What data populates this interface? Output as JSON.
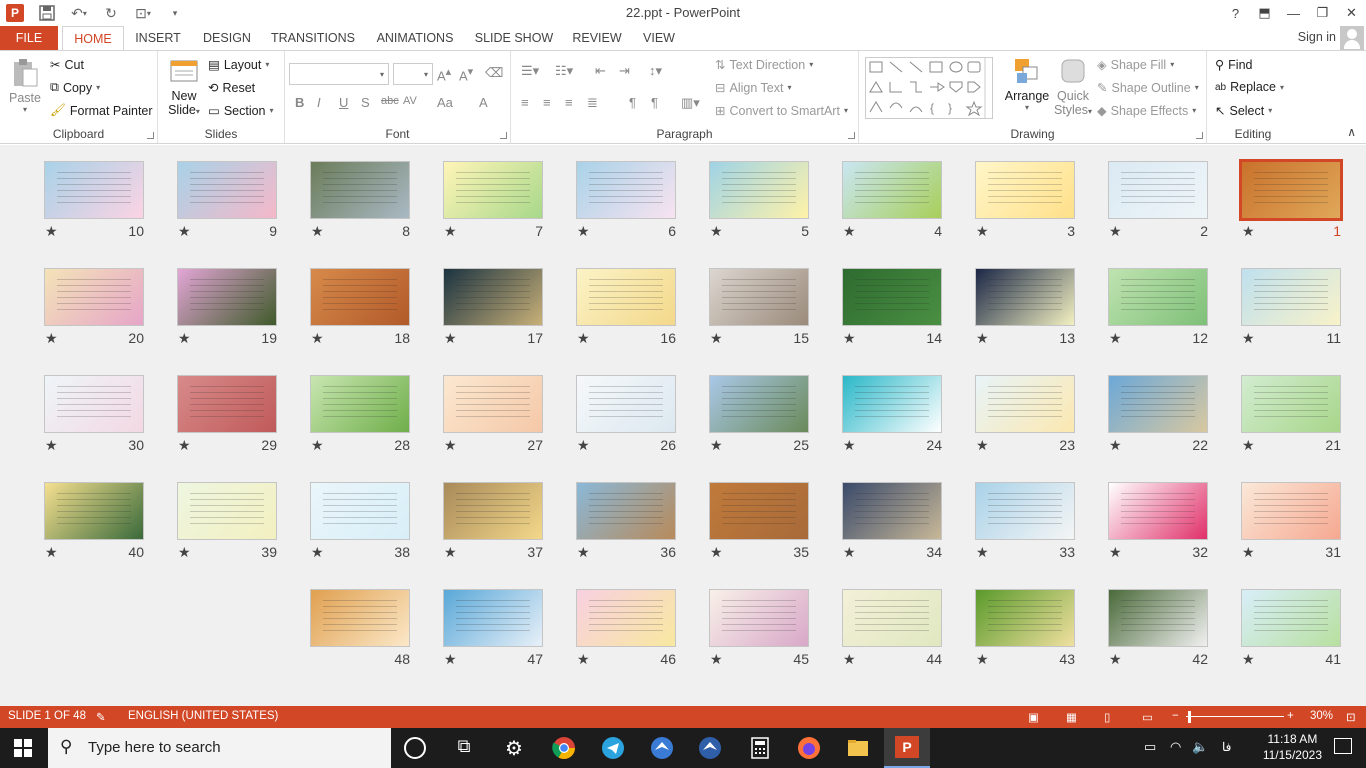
{
  "app": {
    "title": "22.ppt - PowerPoint",
    "help": "?"
  },
  "tabs": [
    "FILE",
    "HOME",
    "INSERT",
    "DESIGN",
    "TRANSITIONS",
    "ANIMATIONS",
    "SLIDE SHOW",
    "REVIEW",
    "VIEW"
  ],
  "active_tab": "HOME",
  "signin": "Sign in",
  "clipboard": {
    "paste": "Paste",
    "cut": "Cut",
    "copy": "Copy",
    "format_painter": "Format Painter",
    "label": "Clipboard"
  },
  "slides_group": {
    "new_slide_1": "New",
    "new_slide_2": "Slide",
    "layout": "Layout",
    "reset": "Reset",
    "section": "Section",
    "label": "Slides"
  },
  "font_group": {
    "label": "Font",
    "bold": "B",
    "italic": "I",
    "underline": "U",
    "shadow": "S",
    "strike": "abc",
    "spacing": "AV",
    "case": "Aa",
    "color": "A"
  },
  "paragraph_group": {
    "label": "Paragraph",
    "text_direction": "Text Direction",
    "align_text": "Align Text",
    "smartart": "Convert to SmartArt"
  },
  "drawing_group": {
    "label": "Drawing",
    "arrange": "Arrange",
    "quick_1": "Quick",
    "quick_2": "Styles",
    "shape_fill": "Shape Fill",
    "shape_outline": "Shape Outline",
    "shape_effects": "Shape Effects"
  },
  "editing_group": {
    "label": "Editing",
    "find": "Find",
    "replace": "Replace",
    "select": "Select"
  },
  "slides": [
    {
      "n": "1",
      "c1": "#c9722c",
      "c2": "#e0a85a"
    },
    {
      "n": "2",
      "c1": "#dbe9f3",
      "c2": "#eef5f8"
    },
    {
      "n": "3",
      "c1": "#fff6c8",
      "c2": "#ffe08a"
    },
    {
      "n": "4",
      "c1": "#c9e6f2",
      "c2": "#a8cf5a"
    },
    {
      "n": "5",
      "c1": "#9fd3e6",
      "c2": "#fff2a8"
    },
    {
      "n": "6",
      "c1": "#a9d2e8",
      "c2": "#f8e3f0"
    },
    {
      "n": "7",
      "c1": "#fff5b8",
      "c2": "#a8d88a"
    },
    {
      "n": "8",
      "c1": "#6b7c5a",
      "c2": "#a9b9c4"
    },
    {
      "n": "9",
      "c1": "#a9d2e8",
      "c2": "#f5b8c8"
    },
    {
      "n": "10",
      "c1": "#a9d2e8",
      "c2": "#fbd3e3"
    },
    {
      "n": "11",
      "c1": "#bfe0ee",
      "c2": "#f8f2c9"
    },
    {
      "n": "12",
      "c1": "#bfe3b0",
      "c2": "#7ec078"
    },
    {
      "n": "13",
      "c1": "#1b2746",
      "c2": "#f3f1c2"
    },
    {
      "n": "14",
      "c1": "#2e6b2f",
      "c2": "#4a8f43"
    },
    {
      "n": "15",
      "c1": "#dcd6d0",
      "c2": "#9a8a7a"
    },
    {
      "n": "16",
      "c1": "#fbf3c6",
      "c2": "#f3d88a"
    },
    {
      "n": "17",
      "c1": "#1b3340",
      "c2": "#c8b078"
    },
    {
      "n": "18",
      "c1": "#d78a4a",
      "c2": "#b25a2a"
    },
    {
      "n": "19",
      "c1": "#e3a6d6",
      "c2": "#3f5a2a"
    },
    {
      "n": "20",
      "c1": "#f3e3b8",
      "c2": "#e6a5c8"
    },
    {
      "n": "21",
      "c1": "#d2ecd0",
      "c2": "#a8d68a"
    },
    {
      "n": "22",
      "c1": "#6ca8d8",
      "c2": "#d8c8a0"
    },
    {
      "n": "23",
      "c1": "#e8f4f8",
      "c2": "#fbe8b0"
    },
    {
      "n": "24",
      "c1": "#2ab7c8",
      "c2": "#ffffff"
    },
    {
      "n": "25",
      "c1": "#a9c8e8",
      "c2": "#6a8a5a"
    },
    {
      "n": "26",
      "c1": "#f5f8fa",
      "c2": "#dce8f0"
    },
    {
      "n": "27",
      "c1": "#fbe8d0",
      "c2": "#f5c8a8"
    },
    {
      "n": "28",
      "c1": "#c8e6b0",
      "c2": "#6fae4a"
    },
    {
      "n": "29",
      "c1": "#d88a8a",
      "c2": "#c05a5a"
    },
    {
      "n": "30",
      "c1": "#eef5f8",
      "c2": "#f3d8e3"
    },
    {
      "n": "31",
      "c1": "#fbe8d8",
      "c2": "#f5a890"
    },
    {
      "n": "32",
      "c1": "#ffffff",
      "c2": "#e0306a"
    },
    {
      "n": "33",
      "c1": "#a9d2e8",
      "c2": "#f5f5f5"
    },
    {
      "n": "34",
      "c1": "#3a4a6a",
      "c2": "#c8b898"
    },
    {
      "n": "35",
      "c1": "#c07a3a",
      "c2": "#a86a3a"
    },
    {
      "n": "36",
      "c1": "#8ab8d8",
      "c2": "#b88a5a"
    },
    {
      "n": "37",
      "c1": "#a88a5a",
      "c2": "#f3d88a"
    },
    {
      "n": "38",
      "c1": "#eaf6fa",
      "c2": "#d8eef8"
    },
    {
      "n": "39",
      "c1": "#eef6e0",
      "c2": "#f3f0c0"
    },
    {
      "n": "40",
      "c1": "#f5e090",
      "c2": "#3a6a3a"
    },
    {
      "n": "41",
      "c1": "#d8eef8",
      "c2": "#b8e0a0"
    },
    {
      "n": "42",
      "c1": "#4a6a3a",
      "c2": "#f0f0f0"
    },
    {
      "n": "43",
      "c1": "#5a9a2a",
      "c2": "#f0e0a0"
    },
    {
      "n": "44",
      "c1": "#f3f0d8",
      "c2": "#e0e8c0"
    },
    {
      "n": "45",
      "c1": "#f8f0e8",
      "c2": "#d8a8c8"
    },
    {
      "n": "46",
      "c1": "#f8d0e0",
      "c2": "#f8e8a0"
    },
    {
      "n": "47",
      "c1": "#5aa8d8",
      "c2": "#e8f0f8"
    },
    {
      "n": "48",
      "c1": "#e0a050",
      "c2": "#fbe8c8"
    }
  ],
  "status": {
    "slide": "SLIDE 1 OF 48",
    "language": "ENGLISH (UNITED STATES)",
    "zoom": "30%"
  },
  "taskbar": {
    "search_placeholder": "Type here to search",
    "lang": "فا",
    "time": "11:18 AM",
    "date": "11/15/2023"
  }
}
